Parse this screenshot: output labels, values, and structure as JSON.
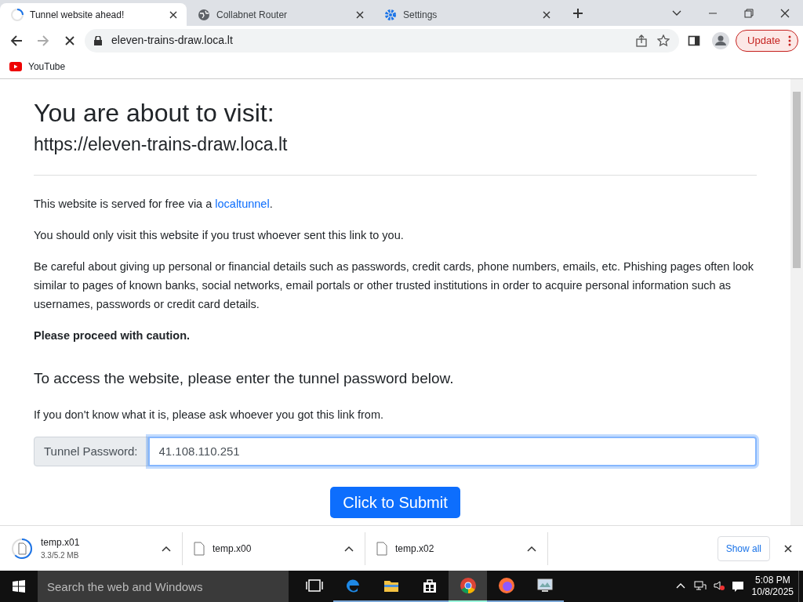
{
  "tabs": [
    {
      "title": "Tunnel website ahead!",
      "selected": true,
      "kind": "loading"
    },
    {
      "title": "Collabnet Router",
      "selected": false,
      "kind": "globe"
    },
    {
      "title": "Settings",
      "selected": false,
      "kind": "gear"
    }
  ],
  "toolbar": {
    "address": "eleven-trains-draw.loca.lt",
    "loading": true,
    "update_button": "Update"
  },
  "bookmarks": [
    {
      "label": "YouTube"
    }
  ],
  "page": {
    "heading": "You are about to visit:",
    "url": "https://eleven-trains-draw.loca.lt",
    "intro": {
      "before": "This website is served for free via a ",
      "link": "localtunnel",
      "after": "."
    },
    "paragraphs": [
      "You should only visit this website if you trust whoever sent this link to you.",
      "Be careful about giving up personal or financial details such as passwords, credit cards, phone numbers, emails, etc. Phishing pages often look similar to pages of known banks, social networks, email portals or other trusted institutions in order to acquire personal information such as usernames, passwords or credit card details."
    ],
    "caution": "Please proceed with caution.",
    "subheading": "To access the website, please enter the tunnel password below.",
    "hint": "If you don't know what it is, please ask whoever you got this link from.",
    "password_label": "Tunnel Password:",
    "password_value": "41.108.110.251",
    "submit": "Click to Submit"
  },
  "downloads": {
    "items": [
      {
        "name": "temp.x01",
        "size": "3.3/5.2 MB"
      },
      {
        "name": "temp.x00"
      },
      {
        "name": "temp.x02"
      }
    ],
    "show_all": "Show all"
  },
  "taskbar": {
    "search_placeholder": "Search the web and Windows",
    "apps": [
      {
        "kind": "taskview",
        "selected": false
      },
      {
        "kind": "edge",
        "selected": false
      },
      {
        "kind": "explorer",
        "selected": false
      },
      {
        "kind": "store",
        "selected": false
      },
      {
        "kind": "chrome",
        "selected": true
      },
      {
        "kind": "firefox",
        "selected": false
      },
      {
        "kind": "monitor",
        "selected": false
      }
    ],
    "time": "5:08 PM",
    "date": "10/8/2025"
  }
}
